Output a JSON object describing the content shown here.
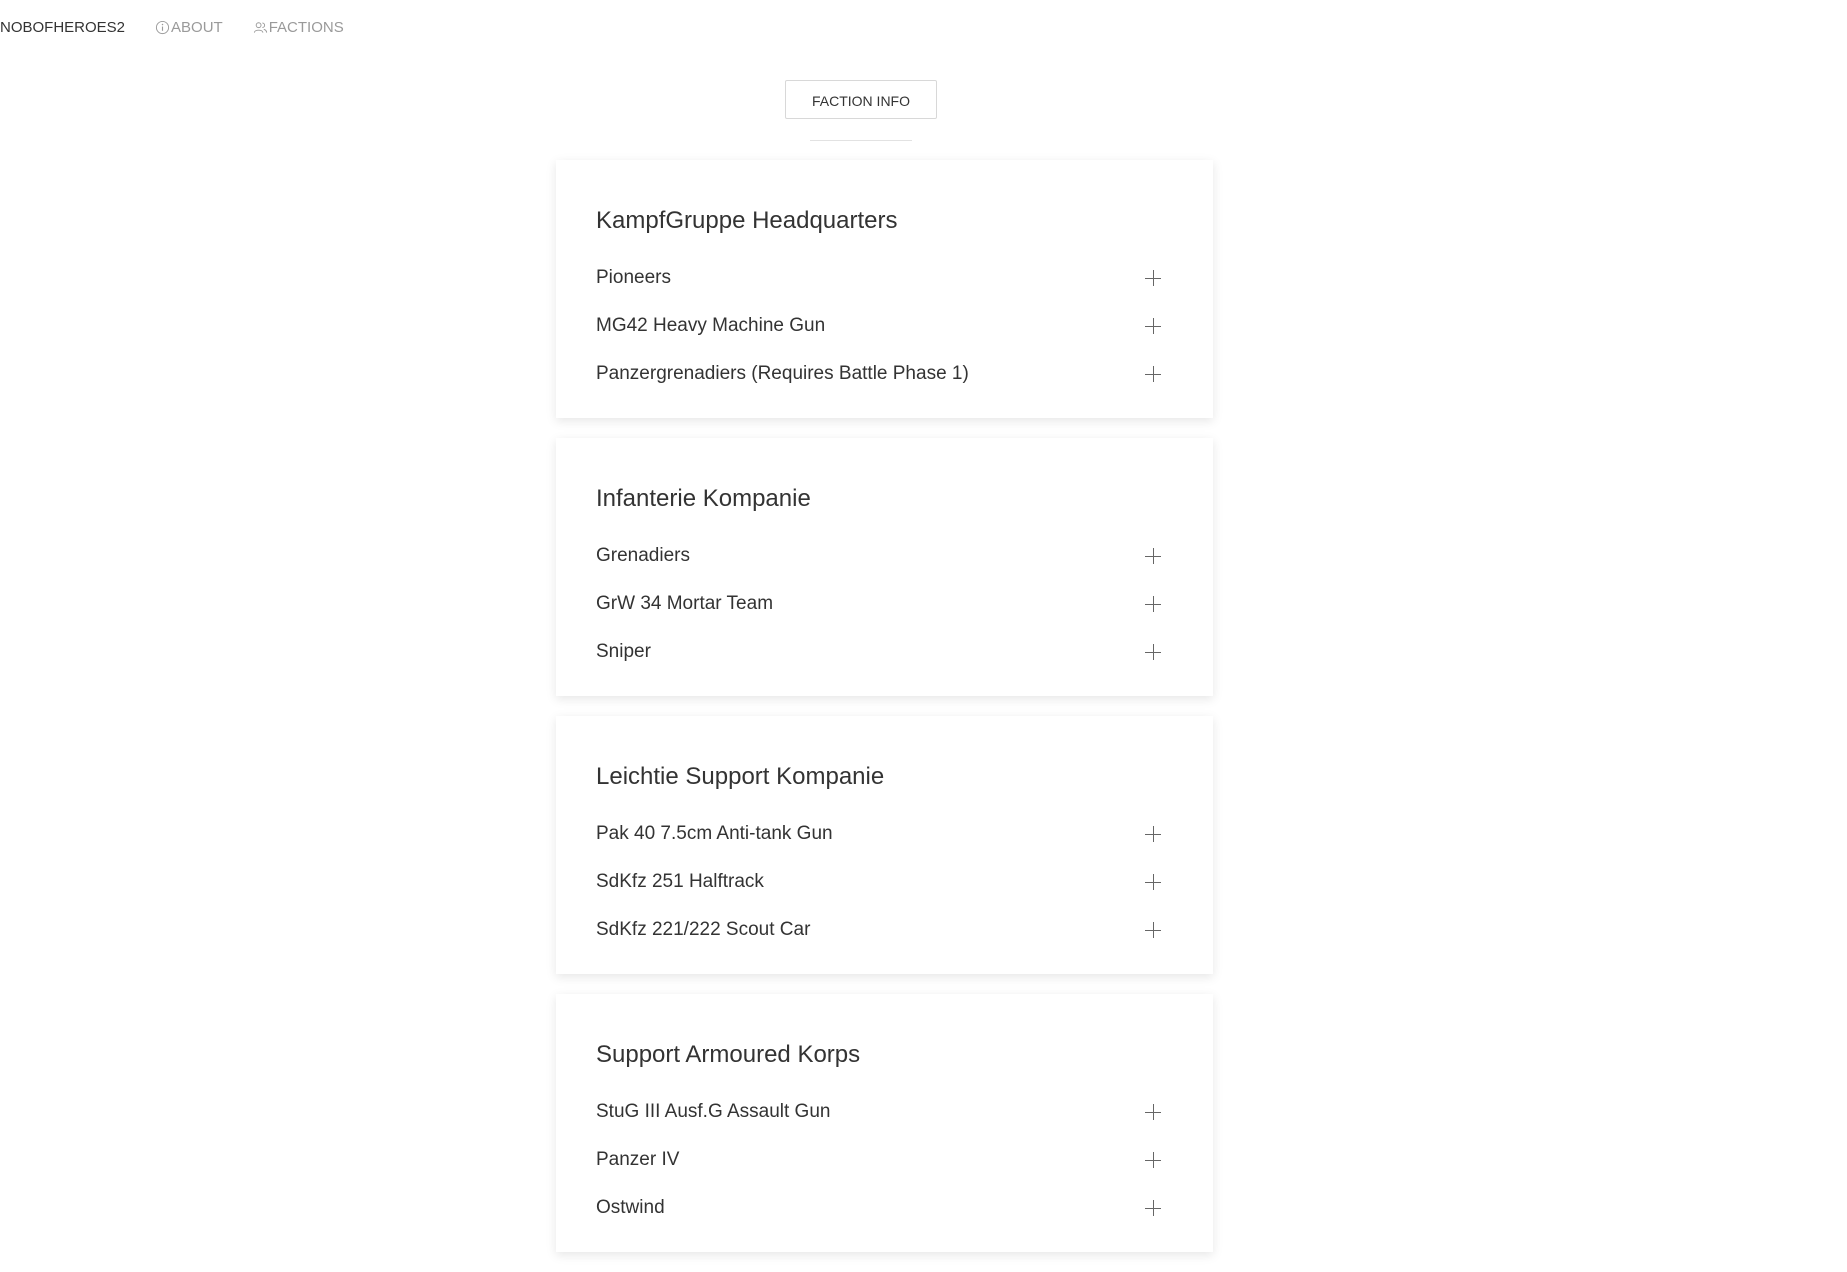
{
  "nav": {
    "brand": "NOBOFHEROES2",
    "about": "ABOUT",
    "factions": "FACTIONS"
  },
  "faction_button": "FACTION INFO",
  "sections": [
    {
      "title": "KampfGruppe Headquarters",
      "units": [
        "Pioneers",
        "MG42 Heavy Machine Gun",
        "Panzergrenadiers (Requires Battle Phase 1)"
      ]
    },
    {
      "title": "Infanterie Kompanie",
      "units": [
        "Grenadiers",
        "GrW 34 Mortar Team",
        "Sniper"
      ]
    },
    {
      "title": "Leichtie Support Kompanie",
      "units": [
        "Pak 40 7.5cm Anti-tank Gun",
        "SdKfz 251 Halftrack",
        "SdKfz 221/222 Scout Car"
      ]
    },
    {
      "title": "Support Armoured Korps",
      "units": [
        "StuG III Ausf.G Assault Gun",
        "Panzer IV",
        "Ostwind"
      ]
    }
  ],
  "icons": {
    "about": "info-icon",
    "factions": "users-icon",
    "expand": "plus-icon"
  }
}
